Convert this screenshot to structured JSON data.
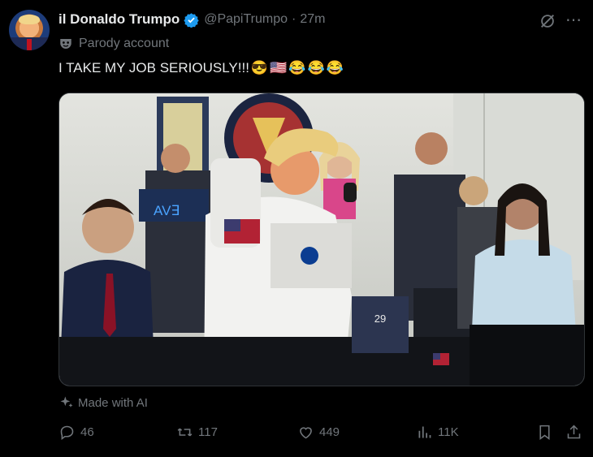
{
  "author": {
    "display_name": "il Donaldo Trumpo",
    "handle": "@PapiTrumpo",
    "separator": "·",
    "timestamp": "27m",
    "label": "Parody account"
  },
  "post": {
    "text": "I TAKE MY JOB SERIOUSLY!!!",
    "emojis": [
      "😎",
      "🇺🇸",
      "😂",
      "😂",
      "😂"
    ]
  },
  "media": {
    "screen_text": "AV∃",
    "patch_number": "29"
  },
  "ai_label": "Made with AI",
  "actions": {
    "replies": "46",
    "reposts": "117",
    "likes": "449",
    "views": "11K"
  },
  "colors": {
    "background": "#000000",
    "primary_text": "#e7e9ea",
    "secondary_text": "#71767b",
    "verified_blue": "#1d9bf0"
  },
  "icons": [
    "verified-badge-icon",
    "grok-icon",
    "more-icon",
    "parody-mask-icon",
    "sparkle-icon",
    "reply-icon",
    "repost-icon",
    "like-icon",
    "views-icon",
    "bookmark-icon",
    "share-icon"
  ]
}
